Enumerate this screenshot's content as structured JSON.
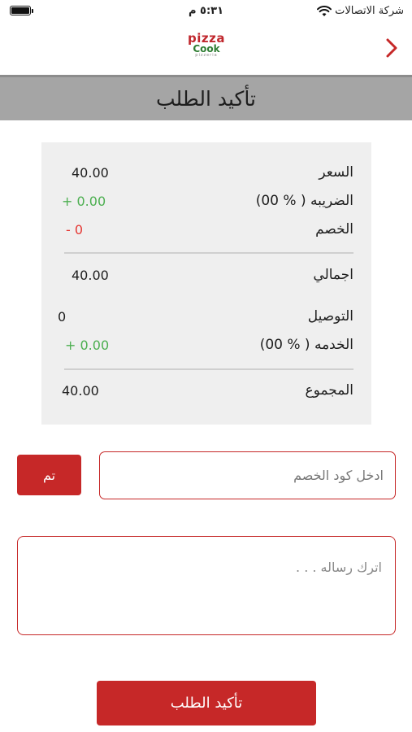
{
  "status_bar": {
    "time": "٥:٣١ م",
    "carrier": "شركة الاتصالات"
  },
  "header": {
    "logo": {
      "pizza": "pizza",
      "cook": "Cook",
      "sub": "pizzeria"
    },
    "back_icon": "chevron-right-icon"
  },
  "page_title": "تأكيد الطلب",
  "summary": {
    "price": {
      "label": "السعر",
      "value": "40.00"
    },
    "tax": {
      "label": "الضريبه ( % 00)",
      "value": "+ 0.00"
    },
    "discount": {
      "label": "الخصم",
      "value": "- 0"
    },
    "total": {
      "label": "اجمالي",
      "value": "40.00"
    },
    "delivery": {
      "label": "التوصيل",
      "value": "0"
    },
    "service": {
      "label": "الخدمه ( % 00)",
      "value": "+ 0.00"
    },
    "grand_total": {
      "label": "المجموع",
      "value": "40.00"
    }
  },
  "discount_code": {
    "placeholder": "ادخل كود الخصم",
    "value": "",
    "apply_label": "تم"
  },
  "message": {
    "placeholder": "اترك رساله . . .",
    "value": ""
  },
  "confirm_label": "تأكيد الطلب",
  "colors": {
    "accent": "#c62828",
    "banner": "#a5a5a5",
    "card": "#efefef",
    "positive": "#4caf50",
    "negative": "#e53935"
  }
}
